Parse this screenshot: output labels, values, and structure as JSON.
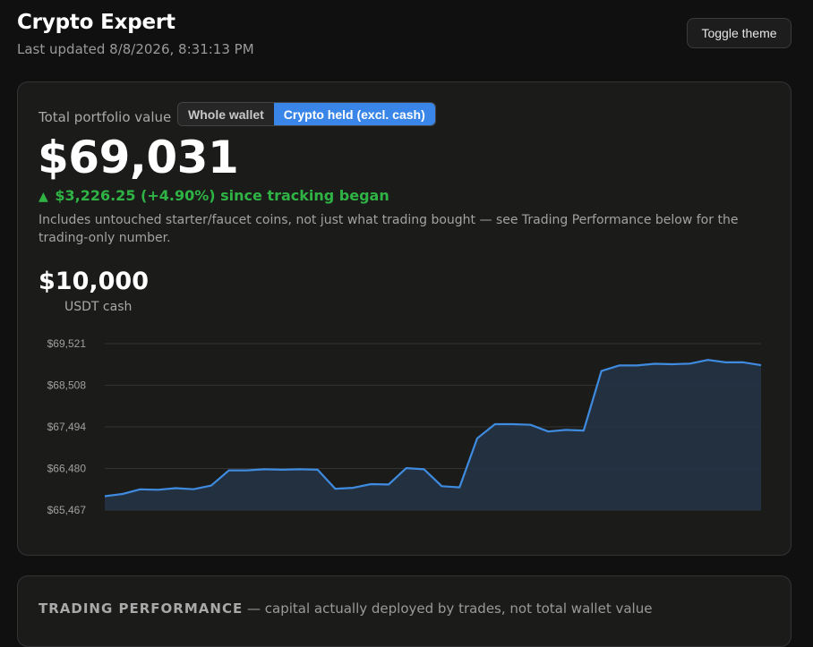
{
  "header": {
    "title": "Crypto Expert",
    "updated": "Last updated 8/8/2026, 8:31:13 PM",
    "toggle_theme": "Toggle theme"
  },
  "portfolio": {
    "label": "Total portfolio value",
    "toggle": {
      "whole": "Whole wallet",
      "crypto": "Crypto held (excl. cash)",
      "selected": "crypto"
    },
    "value": "$69,031",
    "change_arrow": "▲",
    "change": "$3,226.25 (+4.90%) since tracking began",
    "note": "Includes untouched starter/faucet coins, not just what trading bought — see Trading Performance below for the trading-only number.",
    "cash_value": "$10,000",
    "cash_label": "USDT cash"
  },
  "colors": {
    "accent": "#3a86e8",
    "positive": "#2fb344",
    "line": "#3f8be0"
  },
  "chart_data": {
    "type": "area",
    "ylim": [
      65467,
      69521
    ],
    "yticks": [
      69521,
      68508,
      67494,
      66480,
      65467
    ],
    "ytick_labels": [
      "$69,521",
      "$68,508",
      "$67,494",
      "$66,480",
      "$65,467"
    ],
    "grid": true,
    "values": [
      65805,
      65860,
      65972,
      65961,
      66000,
      65975,
      66065,
      66435,
      66435,
      66460,
      66450,
      66460,
      66450,
      65985,
      66010,
      66100,
      66090,
      66490,
      66460,
      66050,
      66020,
      67215,
      67560,
      67560,
      67545,
      67380,
      67420,
      67405,
      68855,
      68990,
      68990,
      69030,
      69020,
      69035,
      69125,
      69065,
      69065,
      68995
    ]
  },
  "trading": {
    "title": "TRADING PERFORMANCE",
    "subtitle": "— capital actually deployed by trades, not total wallet value"
  }
}
